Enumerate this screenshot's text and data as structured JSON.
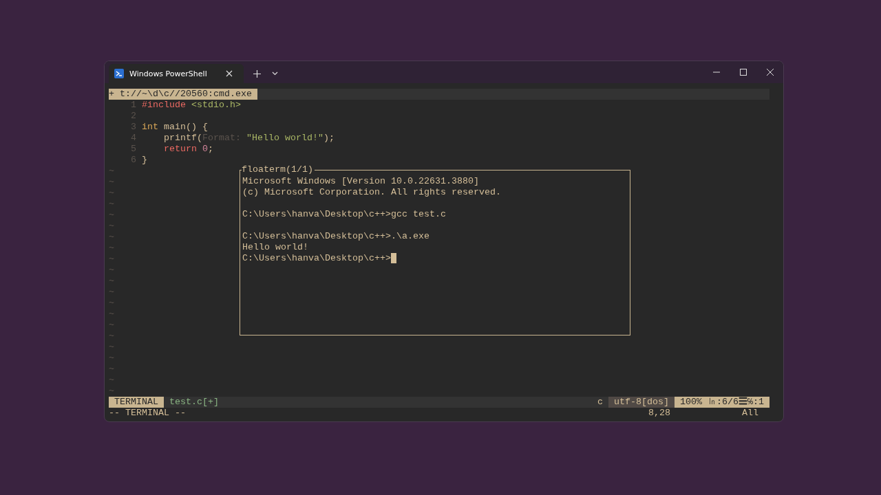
{
  "window": {
    "tab_title": "Windows PowerShell"
  },
  "vim_tabline": {
    "label": "+ t://~\\d\\c//20560:cmd.exe"
  },
  "code_lines": [
    {
      "number": "1",
      "tokens": [
        {
          "text": "#include",
          "kind": "preproc"
        },
        {
          "text": " <stdio.h>",
          "kind": "string"
        }
      ]
    },
    {
      "number": "2"
    },
    {
      "number": "3",
      "tokens": [
        {
          "text": "int",
          "kind": "type"
        },
        {
          "text": " main() {",
          "kind": "plain"
        }
      ]
    },
    {
      "number": "4",
      "tokens": [
        {
          "text": "    printf(",
          "kind": "plain"
        },
        {
          "text": "Format: ",
          "kind": "hint"
        },
        {
          "text": "\"Hello world!\"",
          "kind": "string"
        },
        {
          "text": ");",
          "kind": "plain"
        }
      ]
    },
    {
      "number": "5",
      "tokens": [
        {
          "text": "    return",
          "kind": "keyword"
        },
        {
          "text": " 0",
          "kind": "number"
        },
        {
          "text": ";",
          "kind": "plain"
        }
      ]
    },
    {
      "number": "6",
      "tokens": [
        {
          "text": "}",
          "kind": "plain"
        }
      ]
    }
  ],
  "tildes": [
    "~",
    "~",
    "~",
    "~",
    "~",
    "~",
    "~",
    "~",
    "~",
    "~",
    "~",
    "~",
    "~",
    "~",
    "~",
    "~",
    "~",
    "~",
    "~",
    "~",
    "~"
  ],
  "floaterm": {
    "title": "floaterm(1/1)",
    "blocks": [
      [
        "Microsoft Windows [Version 10.0.22631.3880]",
        "(c) Microsoft Corporation. All rights reserved."
      ],
      [
        "C:\\Users\\hanva\\Desktop\\c++>gcc test.c"
      ],
      [
        "C:\\Users\\hanva\\Desktop\\c++>.\\a.exe",
        "Hello world!",
        "C:\\Users\\hanva\\Desktop\\c++>"
      ]
    ]
  },
  "statusline": {
    "mode": "TERMINAL",
    "file": "test.c[+]",
    "filetype": "c",
    "encoding": "utf-8[dos]",
    "position": "100% ㏑:6/6☰℅:1"
  },
  "cmdline": {
    "message": "-- TERMINAL --",
    "cursor": "8,28",
    "scroll": "All"
  }
}
